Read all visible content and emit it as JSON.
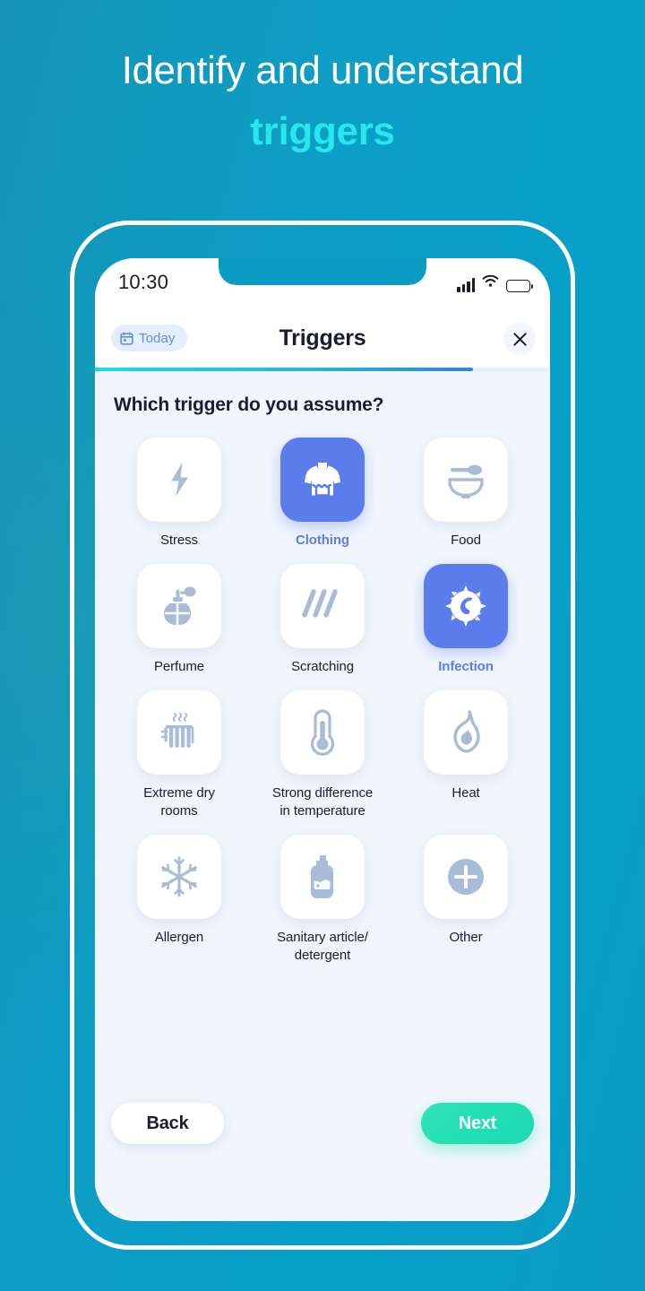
{
  "promo": {
    "headline_line1": "Identify and understand",
    "headline_line2": "triggers",
    "background_color": "#0e9ec4",
    "accent_color": "#27e7ec"
  },
  "status_bar": {
    "time": "10:30",
    "signal_icon": "cellular-signal-icon",
    "wifi_icon": "wifi-icon",
    "battery_icon": "battery-full-icon"
  },
  "header": {
    "today_chip_label": "Today",
    "today_chip_icon": "calendar-icon",
    "title": "Triggers",
    "close_icon": "close-icon"
  },
  "progress": {
    "percent": 83,
    "fill_start_color": "#13dfe8",
    "fill_end_color": "#2b87d4"
  },
  "main": {
    "question": "Which trigger do you assume?",
    "selected_color": "#5b7ced",
    "tile_icon_color": "#a8bcd8",
    "triggers": [
      {
        "label": "Stress",
        "icon": "lightning-bolt-icon",
        "selected": false
      },
      {
        "label": "Clothing",
        "icon": "sweater-icon",
        "selected": true
      },
      {
        "label": "Food",
        "icon": "bowl-spoon-icon",
        "selected": false
      },
      {
        "label": "Perfume",
        "icon": "perfume-bottle-icon",
        "selected": false
      },
      {
        "label": "Scratching",
        "icon": "scratch-lines-icon",
        "selected": false
      },
      {
        "label": "Infection",
        "icon": "bacteria-icon",
        "selected": true
      },
      {
        "label": "Extreme dry rooms",
        "icon": "radiator-icon",
        "selected": false
      },
      {
        "label": "Strong difference in temperature",
        "icon": "thermometer-icon",
        "selected": false
      },
      {
        "label": "Heat",
        "icon": "flame-drop-icon",
        "selected": false
      },
      {
        "label": "Allergen",
        "icon": "snowflake-icon",
        "selected": false
      },
      {
        "label": "Sanitary article/ detergent",
        "icon": "detergent-bottle-icon",
        "selected": false
      },
      {
        "label": "Other",
        "icon": "plus-circle-icon",
        "selected": false
      }
    ]
  },
  "footer": {
    "back_label": "Back",
    "next_label": "Next",
    "next_color": "#24dcb4"
  }
}
